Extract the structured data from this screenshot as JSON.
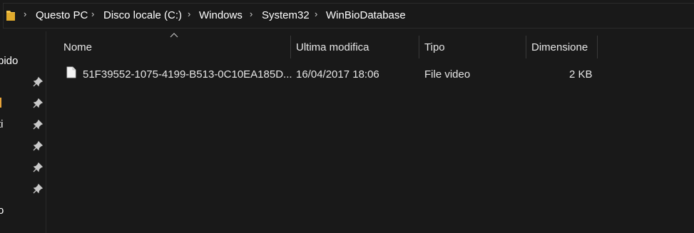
{
  "breadcrumb": {
    "items": [
      "Questo PC",
      "Disco locale (C:)",
      "Windows",
      "System32",
      "WinBioDatabase"
    ]
  },
  "nav": {
    "partial_labels": [
      "pido",
      "i",
      "ti",
      "o"
    ]
  },
  "columns": {
    "name": "Nome",
    "modified": "Ultima modifica",
    "type": "Tipo",
    "size": "Dimensione"
  },
  "files": [
    {
      "name": "51F39552-1075-4199-B513-0C10EA185D...",
      "modified": "16/04/2017 18:06",
      "type": "File video",
      "size": "2 KB"
    }
  ],
  "colors": {
    "background": "#191919",
    "text": "#ffffff",
    "folder": "#f3c44d",
    "accent_orange": "#e8a43a"
  }
}
